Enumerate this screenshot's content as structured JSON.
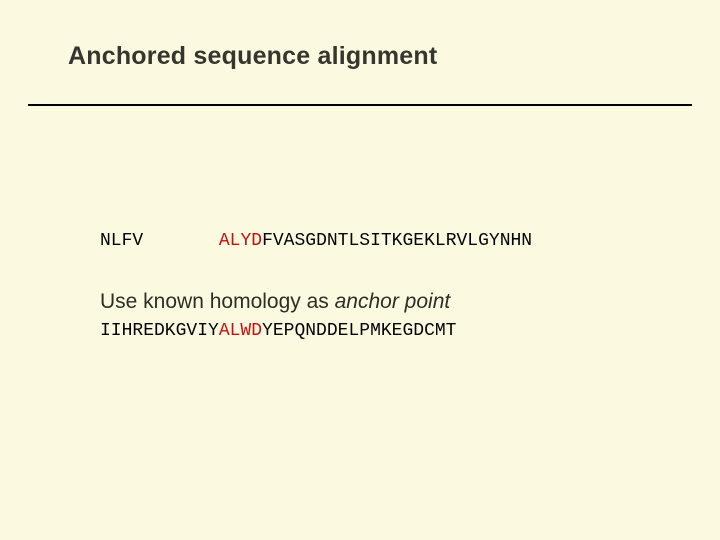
{
  "title": "Anchored sequence alignment",
  "seq1": {
    "pre": "NLFV",
    "gap": "       ",
    "anchor": "ALYD",
    "post": "FVASGDNTLSITKGEKLRVLGYNHN"
  },
  "seq2": {
    "pre": "IIHREDKGVIY",
    "anchor": "ALWD",
    "post": "YEPQNDDELPMKEGDCMT"
  },
  "body": {
    "pre": "Use known homology as ",
    "italic": "anchor point"
  }
}
